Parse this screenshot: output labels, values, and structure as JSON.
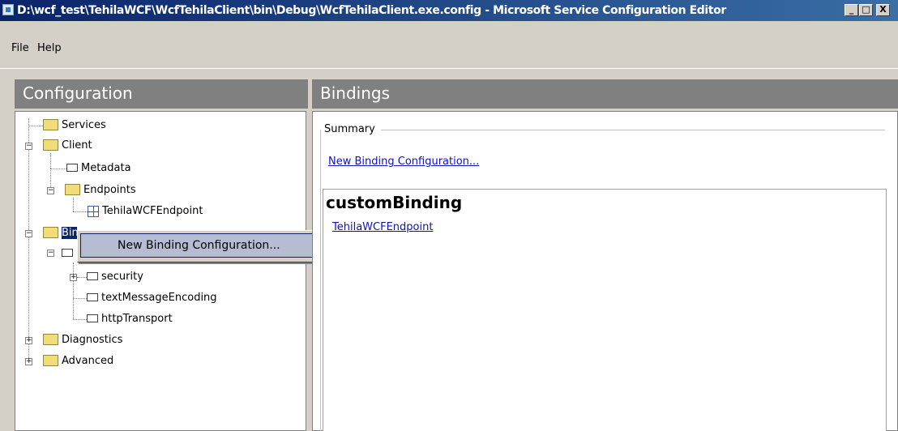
{
  "window": {
    "title": "D:\\wcf_test\\TehilaWCF\\WcfTehilaClient\\bin\\Debug\\WcfTehilaClient.exe.config - Microsoft Service Configuration Editor",
    "icon": "app-config-icon",
    "buttons": {
      "minimize": "_",
      "maximize": "□",
      "close": "X"
    }
  },
  "menu": {
    "file": "File",
    "help": "Help"
  },
  "left_panel": {
    "header": "Configuration",
    "tree": {
      "services": "Services",
      "client": "Client",
      "metadata": "Metadata",
      "endpoints": "Endpoints",
      "tehila_endpoint": "TehilaWCFEndpoint",
      "bindings": "Bindings",
      "security": "security",
      "text_message_encoding": "textMessageEncoding",
      "http_transport": "httpTransport",
      "diagnostics": "Diagnostics",
      "advanced": "Advanced"
    }
  },
  "context_menu": {
    "new_binding": "New Binding Configuration..."
  },
  "right_panel": {
    "header": "Bindings",
    "summary_label": "Summary",
    "new_binding_link": "New Binding Configuration...",
    "binding_type": "customBinding",
    "binding_link": "TehilaWCFEndpoint"
  },
  "colors": {
    "titlebar_start": "#0a246a",
    "titlebar_end": "#3a6ea5",
    "header_bg": "#808080",
    "menu_highlight": "#b6bdd2",
    "link": "#1010c0"
  }
}
